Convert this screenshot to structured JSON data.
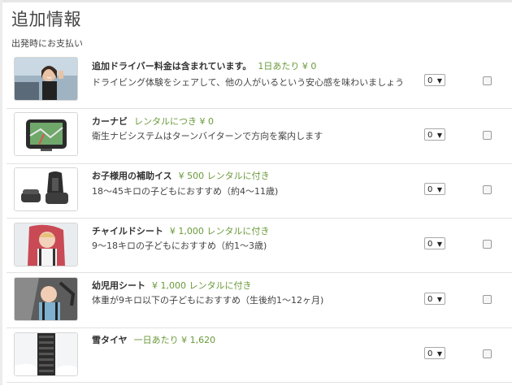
{
  "page": {
    "title": "追加情報",
    "subtitle": "出発時にお支払い"
  },
  "options": [
    {
      "name": "追加ドライバー料金は含まれています。",
      "price": "1日あたり ¥ 0",
      "description": "ドライビング体験をシェアして、他の人がいるという安心感を味わいましょう",
      "quantity": "0",
      "checked": false,
      "image": "driver-photo"
    },
    {
      "name": "カーナビ",
      "price": "レンタルにつき ¥ 0",
      "description": "衛生ナビシステムはターンバイターンで方向を案内します",
      "quantity": "0",
      "checked": false,
      "image": "gps-navigation-device"
    },
    {
      "name": "お子様用の補助イス",
      "price": "¥ 500 レンタルに付き",
      "description": "18～45キロの子どもにおすすめ（約4～11歳)",
      "quantity": "0",
      "checked": false,
      "image": "booster-seat"
    },
    {
      "name": "チャイルドシート",
      "price": "¥ 1,000 レンタルに付き",
      "description": "9～18キロの子どもにおすすめ（約1～3歳)",
      "quantity": "0",
      "checked": false,
      "image": "child-seat"
    },
    {
      "name": "幼児用シート",
      "price": "¥ 1,000 レンタルに付き",
      "description": "体重が9キロ以下の子どもにおすすめ（生後約1～12ヶ月)",
      "quantity": "0",
      "checked": false,
      "image": "infant-seat"
    },
    {
      "name": "雪タイヤ",
      "price": "一日あたり ¥ 1,620",
      "description": "",
      "quantity": "0",
      "checked": false,
      "image": "snow-tire"
    }
  ],
  "colors": {
    "price_text": "#6a9a3a",
    "divider": "#e2e2e2"
  }
}
